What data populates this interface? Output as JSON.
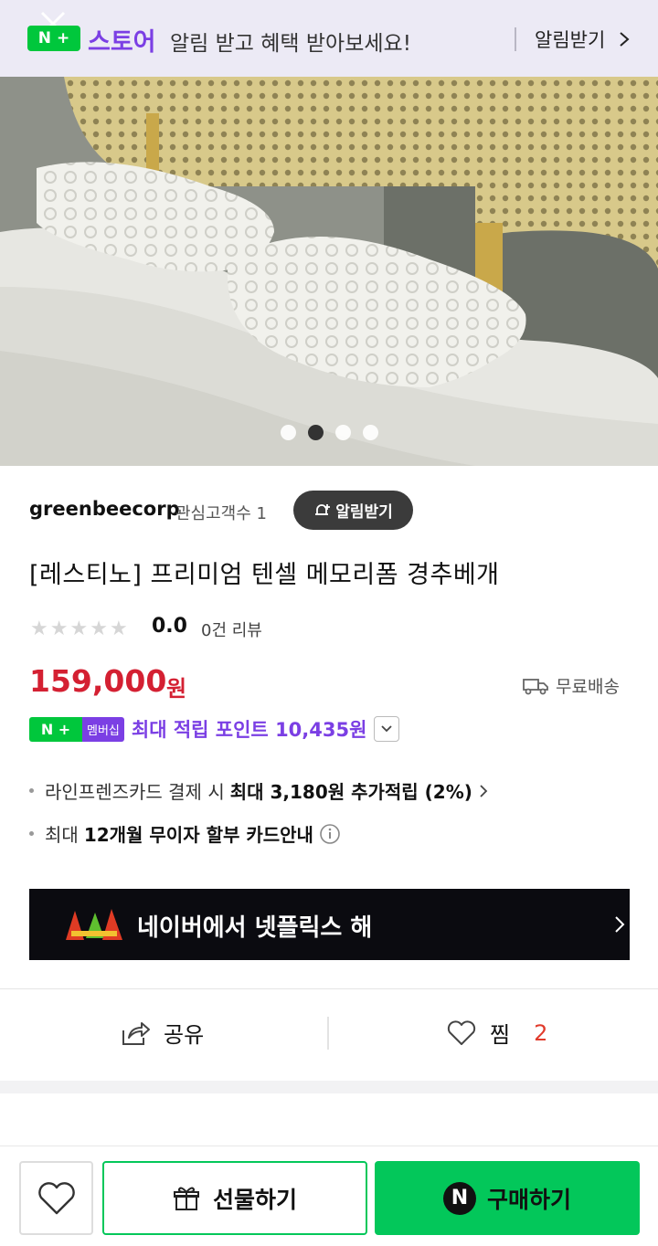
{
  "banner": {
    "logo_badge": "N +",
    "store_name": "스토어",
    "promo_text": "알림 받고 혜택 받아보세요!",
    "alarm_link": "알림받기",
    "bg_color": "#eceaf5",
    "store_color": "#7b3fe4"
  },
  "gallery": {
    "slide_count": 4,
    "active_index": 1
  },
  "seller": {
    "name": "greenbeecorp",
    "fans": "관심고객수 1",
    "alarm_button": "알림받기"
  },
  "product": {
    "title": "[레스티노] 프리미엄 텐셀 메모리폼 경추베개",
    "rating": "0.0",
    "review_count": "0건 리뷰",
    "stars_filled": 0,
    "price": "159,000",
    "currency": "원",
    "shipping": "무료배송",
    "price_color": "#d42032"
  },
  "membership": {
    "badge": "N +",
    "tag": "멤버십",
    "points_text": "최대 적립 포인트 10,435원"
  },
  "benefits": [
    {
      "prefix": "라인프렌즈카드 결제 시",
      "highlight": "최대 3,180원 추가적립 (2%)"
    },
    {
      "prefix": "최대",
      "highlight": "12개월 무이자 할부 카드안내"
    }
  ],
  "netflix_banner": {
    "text": "네이버에서 넷플릭스 해"
  },
  "actions": {
    "share_label": "공유",
    "zzim_label": "찜",
    "zzim_count": "2"
  },
  "bottom": {
    "gift_label": "선물하기",
    "buy_label": "구매하기",
    "buy_badge": "N",
    "buy_color": "#03c75a"
  }
}
